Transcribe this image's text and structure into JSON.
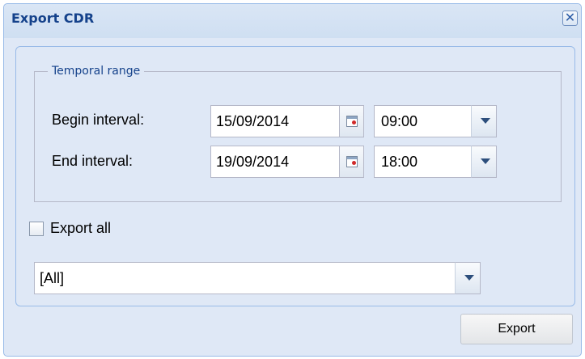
{
  "dialog": {
    "title": "Export CDR",
    "close_glyph": "✕"
  },
  "temporal_range": {
    "legend": "Temporal range",
    "begin": {
      "label": "Begin interval:",
      "date": "15/09/2014",
      "time": "09:00"
    },
    "end": {
      "label": "End interval:",
      "date": "19/09/2014",
      "time": "18:00"
    }
  },
  "export_all": {
    "label": "Export all",
    "checked": false
  },
  "filter_select": {
    "value": "[All]"
  },
  "buttons": {
    "export_label": "Export"
  },
  "icons": {
    "calendar": "calendar-icon",
    "dropdown": "chevron-down-icon",
    "close": "close-icon"
  },
  "colors": {
    "title": "#15428b",
    "panel_bg": "#dfe8f6",
    "border": "#99bbe8"
  }
}
